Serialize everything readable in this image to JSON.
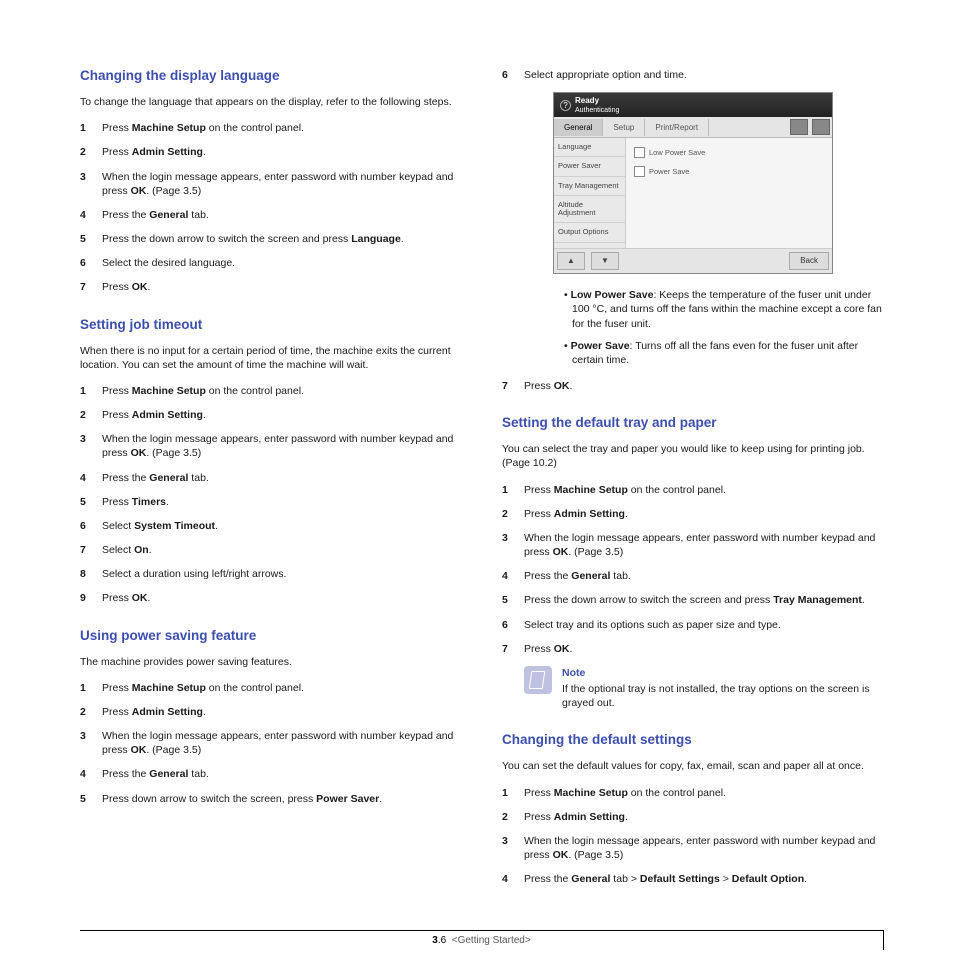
{
  "left": {
    "h1": "Changing the display language",
    "p1": "To change the language that appears on the display, refer to the following steps.",
    "s1": [
      "Press <b>Machine Setup</b> on the control panel.",
      "Press <b>Admin Setting</b>.",
      "When the login message appears, enter password with number keypad and press <b>OK</b>. (Page 3.5)",
      "Press the <b>General</b> tab.",
      "Press the down arrow to switch the screen and press <b>Language</b>.",
      "Select the desired language.",
      "Press <b>OK</b>."
    ],
    "h2": "Setting job timeout",
    "p2": "When there is no input for a certain period of time, the machine exits the current location. You can set the amount of time the machine will wait.",
    "s2": [
      "Press <b>Machine Setup</b> on the control panel.",
      "Press <b>Admin Setting</b>.",
      "When the login message appears, enter password with number keypad and press <b>OK</b>. (Page 3.5)",
      "Press the <b>General</b> tab.",
      "Press <b>Timers</b>.",
      "Select <b>System Timeout</b>.",
      "Select <b>On</b>.",
      "Select a duration using left/right arrows.",
      "Press <b>OK</b>."
    ],
    "h3": "Using power saving feature",
    "p3": "The machine provides power saving features.",
    "s3": [
      "Press <b>Machine Setup</b> on the control panel.",
      "Press <b>Admin Setting</b>.",
      "When the login message appears, enter password with number keypad and press <b>OK</b>. (Page 3.5)",
      "Press the <b>General</b> tab.",
      "Press down arrow to switch the screen, press <b>Power Saver</b>."
    ]
  },
  "right": {
    "step6num": "6",
    "step6txt": "Select appropriate option and time.",
    "fig": {
      "ready": "Ready",
      "auth": "Authenticating",
      "tabs": [
        "General",
        "Setup",
        "Print/Report"
      ],
      "side": [
        "Language",
        "Power Saver",
        "Tray Management",
        "Altitude Adjustment",
        "Output Options"
      ],
      "opt1": "Low Power Save",
      "opt2": "Power Save",
      "back": "Back"
    },
    "bul": [
      "<b>Low Power Save</b>: Keeps the temperature of the fuser unit under 100 °C, and turns off the fans within the machine except a core fan for the fuser unit.",
      "<b>Power Save</b>: Turns off all the fans even for the fuser unit after certain time."
    ],
    "step7num": "7",
    "step7txt": "Press <b>OK</b>.",
    "h1": "Setting the default tray and paper",
    "p1": "You can select the tray and paper you would like to keep using for printing job. (Page 10.2)",
    "s1": [
      "Press <b>Machine Setup</b> on the control panel.",
      "Press <b>Admin Setting</b>.",
      "When the login message appears, enter password with number keypad and press <b>OK</b>. (Page 3.5)",
      "Press the <b>General</b> tab.",
      "Press the down arrow to switch the screen and press <b>Tray Management</b>.",
      "Select tray and its options such as paper size and type.",
      "Press <b>OK</b>."
    ],
    "note_title": "Note",
    "note_body": "If the optional tray is not installed, the tray options on the screen is grayed out.",
    "h2": "Changing the default settings",
    "p2": "You can set the default values for copy, fax, email, scan and paper all at once.",
    "s2": [
      "Press <b>Machine Setup</b> on the control panel.",
      "Press <b>Admin Setting</b>.",
      "When the login message appears, enter password with number keypad and press <b>OK</b>. (Page 3.5)",
      "Press the <b>General</b> tab > <b>Default Settings</b> > <b>Default Option</b>."
    ]
  },
  "footer": {
    "page": "3",
    "sub": ".6",
    "crumb": "<Getting Started>"
  }
}
